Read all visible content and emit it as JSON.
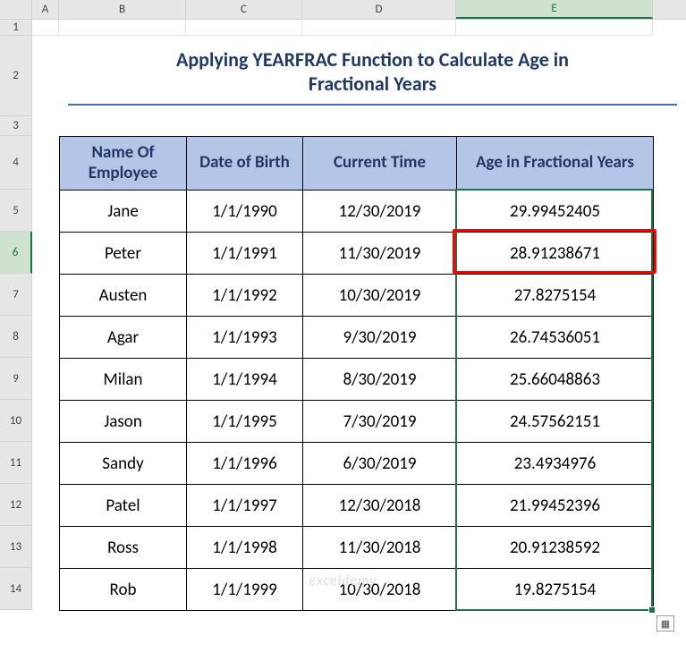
{
  "columns": {
    "A": "A",
    "B": "B",
    "C": "C",
    "D": "D",
    "E": "E"
  },
  "rowlabels": [
    "1",
    "2",
    "3",
    "4",
    "5",
    "6",
    "7",
    "8",
    "9",
    "10",
    "11",
    "12",
    "13",
    "14"
  ],
  "selected_column": "E",
  "selected_row": "6",
  "title_line1": "Applying YEARFRAC Function to Calculate Age in",
  "title_line2": "Fractional Years",
  "headers": {
    "name": "Name Of Employee",
    "dob": "Date of Birth",
    "current": "Current Time",
    "age": "Age in Fractional Years"
  },
  "rows": [
    {
      "name": "Jane",
      "dob": "1/1/1990",
      "current": "12/30/2019",
      "age": "29.99452405"
    },
    {
      "name": "Peter",
      "dob": "1/1/1991",
      "current": "11/30/2019",
      "age": "28.91238671"
    },
    {
      "name": "Austen",
      "dob": "1/1/1992",
      "current": "10/30/2019",
      "age": "27.8275154"
    },
    {
      "name": "Agar",
      "dob": "1/1/1993",
      "current": "9/30/2019",
      "age": "26.74536051"
    },
    {
      "name": "Milan",
      "dob": "1/1/1994",
      "current": "8/30/2019",
      "age": "25.66048863"
    },
    {
      "name": "Jason",
      "dob": "1/1/1995",
      "current": "7/30/2019",
      "age": "24.57562151"
    },
    {
      "name": "Sandy",
      "dob": "1/1/1996",
      "current": "6/30/2019",
      "age": "23.4934976"
    },
    {
      "name": "Patel",
      "dob": "1/1/1997",
      "current": "12/30/2018",
      "age": "21.99452396"
    },
    {
      "name": "Ross",
      "dob": "1/1/1998",
      "current": "11/30/2018",
      "age": "20.91238592"
    },
    {
      "name": "Rob",
      "dob": "1/1/1999",
      "current": "10/30/2018",
      "age": "19.8275154"
    }
  ],
  "highlighted_row_index": 1,
  "watermark": "exceldemy",
  "autofill_glyph": "▦"
}
